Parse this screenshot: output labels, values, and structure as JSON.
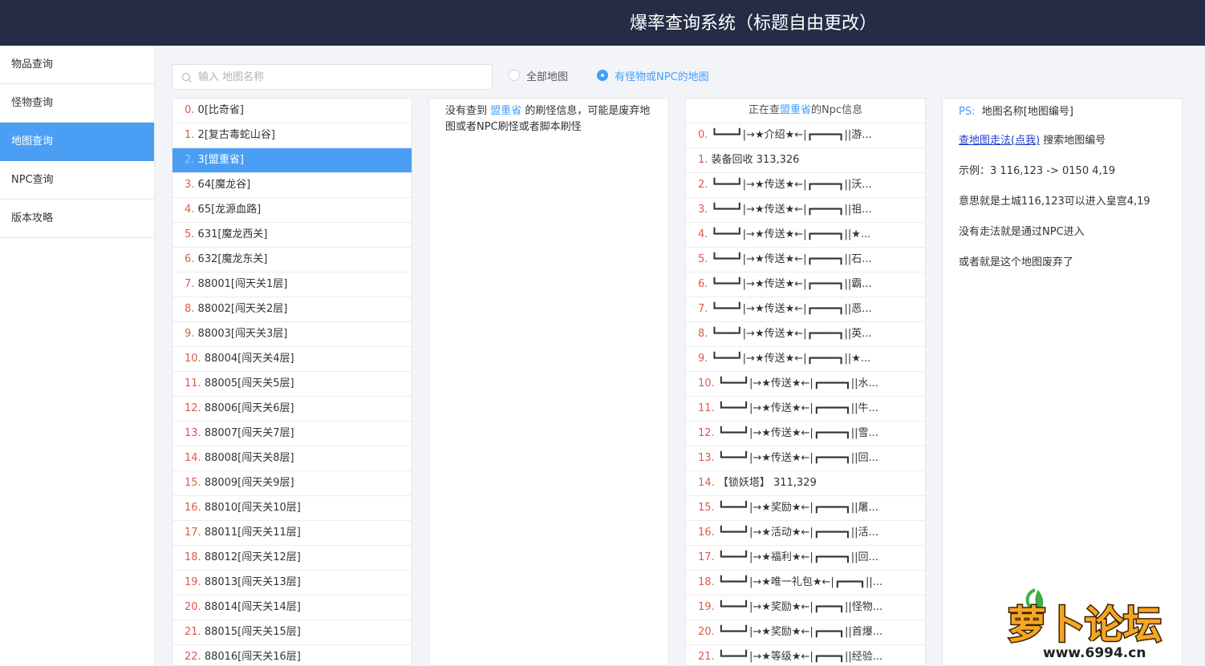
{
  "header": {
    "title": "爆率查询系统（标题自由更改）"
  },
  "sidebar": {
    "items": [
      {
        "label": "物品查询",
        "active": false
      },
      {
        "label": "怪物查询",
        "active": false
      },
      {
        "label": "地图查询",
        "active": true
      },
      {
        "label": "NPC查询",
        "active": false
      },
      {
        "label": "版本攻略",
        "active": false
      }
    ]
  },
  "search": {
    "placeholder": "输入 地图名称",
    "value": ""
  },
  "filters": {
    "all_label": "全部地图",
    "monster_label": "有怪物或NPC的地图",
    "selected": "monster"
  },
  "map_list": [
    {
      "index": "0.",
      "label": "0[比奇省]"
    },
    {
      "index": "1.",
      "label": "2[复古毒蛇山谷]"
    },
    {
      "index": "2.",
      "label": "3[盟重省]",
      "selected": true
    },
    {
      "index": "3.",
      "label": "64[魔龙谷]"
    },
    {
      "index": "4.",
      "label": "65[龙源血路]"
    },
    {
      "index": "5.",
      "label": "631[魔龙西关]"
    },
    {
      "index": "6.",
      "label": "632[魔龙东关]"
    },
    {
      "index": "7.",
      "label": "88001[闯天关1层]"
    },
    {
      "index": "8.",
      "label": "88002[闯天关2层]"
    },
    {
      "index": "9.",
      "label": "88003[闯天关3层]"
    },
    {
      "index": "10.",
      "label": "88004[闯天关4层]"
    },
    {
      "index": "11.",
      "label": "88005[闯天关5层]"
    },
    {
      "index": "12.",
      "label": "88006[闯天关6层]"
    },
    {
      "index": "13.",
      "label": "88007[闯天关7层]"
    },
    {
      "index": "14.",
      "label": "88008[闯天关8层]"
    },
    {
      "index": "15.",
      "label": "88009[闯天关9层]"
    },
    {
      "index": "16.",
      "label": "88010[闯天关10层]"
    },
    {
      "index": "17.",
      "label": "88011[闯天关11层]"
    },
    {
      "index": "18.",
      "label": "88012[闯天关12层]"
    },
    {
      "index": "19.",
      "label": "88013[闯天关13层]"
    },
    {
      "index": "20.",
      "label": "88014[闯天关14层]"
    },
    {
      "index": "21.",
      "label": "88015[闯天关15层]"
    },
    {
      "index": "22.",
      "label": "88016[闯天关16层]"
    }
  ],
  "refresh_info": {
    "prefix": "没有查到",
    "map_name": "盟重省",
    "suffix": "的刷怪信息，可能是废弃地图或者NPC刷怪或者脚本刷怪"
  },
  "npc_panel": {
    "head_prefix": "正在查",
    "head_map": "盟重省",
    "head_suffix": "的Npc信息",
    "items": [
      {
        "index": "0.",
        "label": "┗━━━┛|→★介绍★←|┏━━━━┓||游..."
      },
      {
        "index": "1.",
        "label": "装备回收 313,326"
      },
      {
        "index": "2.",
        "label": "┗━━━┛|→★传送★←|┏━━━━┓||沃..."
      },
      {
        "index": "3.",
        "label": "┗━━━┛|→★传送★←|┏━━━━┓||祖..."
      },
      {
        "index": "4.",
        "label": "┗━━━┛|→★传送★←|┏━━━━┓||★..."
      },
      {
        "index": "5.",
        "label": "┗━━━┛|→★传送★←|┏━━━━┓||石..."
      },
      {
        "index": "6.",
        "label": "┗━━━┛|→★传送★←|┏━━━━┓||霸..."
      },
      {
        "index": "7.",
        "label": "┗━━━┛|→★传送★←|┏━━━━┓||恶..."
      },
      {
        "index": "8.",
        "label": "┗━━━┛|→★传送★←|┏━━━━┓||英..."
      },
      {
        "index": "9.",
        "label": "┗━━━┛|→★传送★←|┏━━━━┓||★..."
      },
      {
        "index": "10.",
        "label": "┗━━━┛|→★传送★←|┏━━━━┓||水..."
      },
      {
        "index": "11.",
        "label": "┗━━━┛|→★传送★←|┏━━━━┓||牛..."
      },
      {
        "index": "12.",
        "label": "┗━━━┛|→★传送★←|┏━━━━┓||雪..."
      },
      {
        "index": "13.",
        "label": "┗━━━┛|→★传送★←|┏━━━━┓||回..."
      },
      {
        "index": "14.",
        "label": "【锁妖塔】 311,329"
      },
      {
        "index": "15.",
        "label": "┗━━━┛|→★奖励★←|┏━━━━┓||屠..."
      },
      {
        "index": "16.",
        "label": "┗━━━┛|→★活动★←|┏━━━━┓||活..."
      },
      {
        "index": "17.",
        "label": "┗━━━┛|→★福利★←|┏━━━━┓||回..."
      },
      {
        "index": "18.",
        "label": "┗━━━┛|→★唯一礼包★←|┏━━━┓||..."
      },
      {
        "index": "19.",
        "label": "┗━━━┛|→★奖励★←|┏━━━┓||怪物..."
      },
      {
        "index": "20.",
        "label": "┗━━━┛|→★奖励★←|┏━━━┓||首爆..."
      },
      {
        "index": "21.",
        "label": "┗━━━┛|→★等级★←|┏━━━┓||经验..."
      }
    ]
  },
  "ps_panel": {
    "ps_prefix": "PS:",
    "ps_text": "地图名称[地图编号]",
    "link_label": "查地图走法(点我)",
    "link_suffix": "搜索地图编号",
    "example": "示例：3 116,123 -> 0150 4,19",
    "meaning": "意思就是土城116,123可以进入皇宫4,19",
    "no_route": "没有走法就是通过NPC进入",
    "abandoned": "或者就是这个地图废弃了"
  },
  "logo": {
    "text": "萝卜论坛",
    "url_text": "www.6994.cn",
    "brand_color": "#f5a623"
  }
}
